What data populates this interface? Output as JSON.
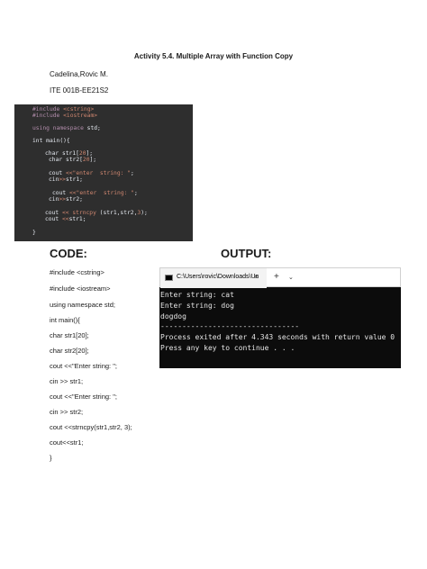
{
  "document": {
    "title": "Activity 5.4. Multiple Array with Function Copy",
    "author": "Cadelina,Rovic M.",
    "section": "ITE 001B-EE21S2"
  },
  "headings": {
    "code": "CODE:",
    "output": "OUTPUT:"
  },
  "code_lines": [
    "#include <cstring>",
    "#include <iostream>",
    "using namespace std;",
    "int main(){",
    "char str1[20];",
    "char str2[20];",
    "cout <<\"Enter string: \";",
    "cin >> str1;",
    "cout <<\"Enter string: \";",
    "cin >> str2;",
    "cout <<strncpy(str1,str2, 3);",
    "cout<<str1;",
    "}"
  ],
  "terminal": {
    "tab_title": "C:\\Users\\rovic\\Downloads\\Un",
    "close_glyph": "×",
    "new_tab_glyph": "+",
    "dropdown_glyph": "⌄",
    "lines": [
      "Enter string: cat",
      "Enter string: dog",
      "dogdog",
      "--------------------------------",
      "Process exited after 4.343 seconds with return value 0",
      "Press any key to continue . . ."
    ]
  }
}
